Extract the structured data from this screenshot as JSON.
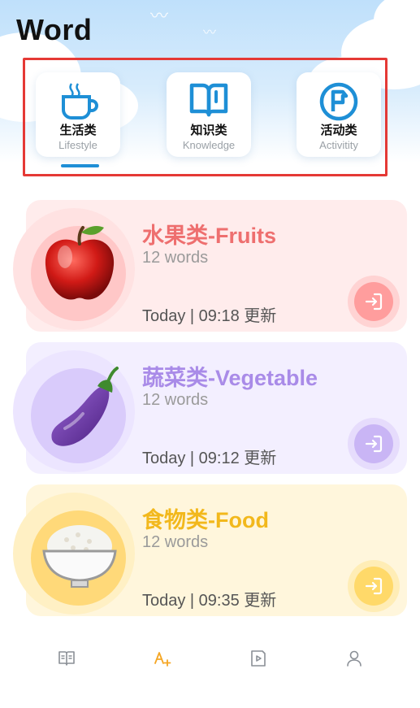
{
  "app": {
    "title": "Word"
  },
  "categories": [
    {
      "label": "生活类",
      "sublabel": "Lifestyle",
      "icon": "coffee-cup-icon",
      "selected": true
    },
    {
      "label": "知识类",
      "sublabel": "Knowledge",
      "icon": "book-icon",
      "selected": false
    },
    {
      "label": "活动类",
      "sublabel": "Activitity",
      "icon": "flag-circle-icon",
      "selected": false
    }
  ],
  "word_lists": [
    {
      "title": "水果类-Fruits",
      "count": "12 words",
      "updated": "Today | 09:18 更新",
      "icon": "apple-icon",
      "accent": "#ee6f6f"
    },
    {
      "title": "蔬菜类-Vegetable",
      "count": "12 words",
      "updated": "Today | 09:12 更新",
      "icon": "eggplant-icon",
      "accent": "#a98be8"
    },
    {
      "title": "食物类-Food",
      "count": "12 words",
      "updated": "Today | 09:35 更新",
      "icon": "rice-bowl-icon",
      "accent": "#f2b81c"
    }
  ],
  "bottom_nav": [
    {
      "icon": "book-open-icon",
      "active": false
    },
    {
      "icon": "vocabulary-icon",
      "active": true
    },
    {
      "icon": "video-icon",
      "active": false
    },
    {
      "icon": "profile-icon",
      "active": false
    }
  ],
  "colors": {
    "brand_blue": "#1e8fd6",
    "active_nav": "#f5a623",
    "highlight_frame": "#e53935"
  }
}
